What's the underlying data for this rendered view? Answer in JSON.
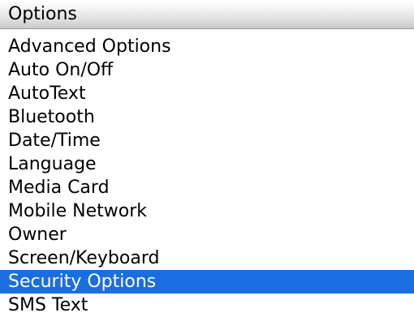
{
  "screen": {
    "title": "Options"
  },
  "options": {
    "selected_index": 11,
    "selected_color": "#1a6ee0",
    "items": [
      {
        "label": "Advanced Options"
      },
      {
        "label": "Auto On/Off"
      },
      {
        "label": "AutoText"
      },
      {
        "label": "Bluetooth"
      },
      {
        "label": "Date/Time"
      },
      {
        "label": "Language"
      },
      {
        "label": "Media Card"
      },
      {
        "label": "Mobile Network"
      },
      {
        "label": "Owner"
      },
      {
        "label": "Screen/Keyboard"
      },
      {
        "label": "Security Options"
      },
      {
        "label": "SMS Text"
      }
    ]
  }
}
